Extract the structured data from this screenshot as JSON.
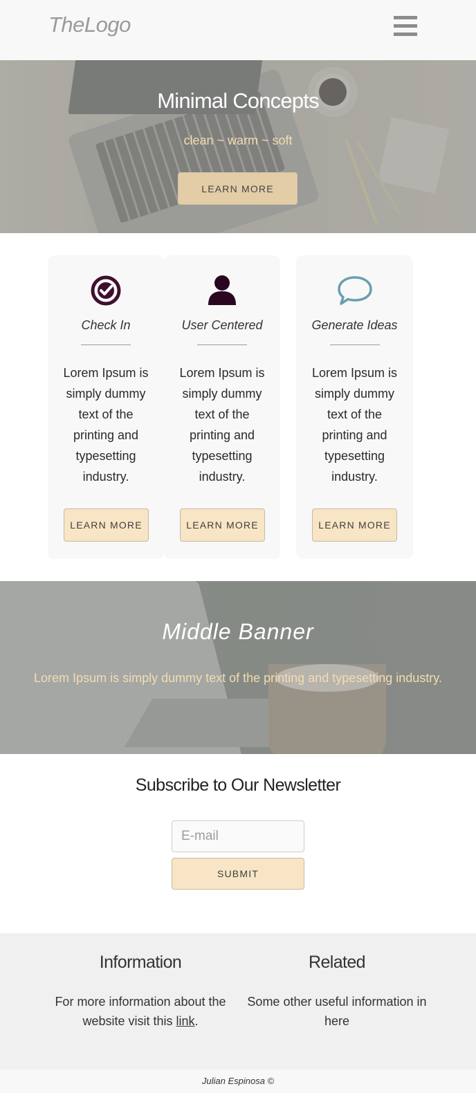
{
  "header": {
    "logo": "TheLogo",
    "menu_icon": "hamburger-menu-icon"
  },
  "hero": {
    "title": "Minimal Concepts",
    "subtitle": "clean ~ warm ~ soft",
    "button_label": "LEARN MORE"
  },
  "cards": [
    {
      "icon": "check-circle-icon",
      "title": "Check In",
      "text": "Lorem Ipsum is simply dummy text of the printing and typesetting industry.",
      "button_label": "LEARN MORE",
      "icon_color": "#3f0f2f"
    },
    {
      "icon": "user-icon",
      "title": "User Centered",
      "text": "Lorem Ipsum is simply dummy text of the printing and typesetting industry.",
      "button_label": "LEARN MORE",
      "icon_color": "#2a0620"
    },
    {
      "icon": "speech-bubble-icon",
      "title": "Generate Ideas",
      "text": "Lorem Ipsum is simply dummy text of the printing and typesetting industry.",
      "button_label": "LEARN MORE",
      "icon_color": "#6b9eae"
    }
  ],
  "middle_banner": {
    "title": "Middle Banner",
    "text": "Lorem Ipsum is simply dummy text of the printing and typesetting industry."
  },
  "newsletter": {
    "title": "Subscribe to Our Newsletter",
    "email_placeholder": "E-mail",
    "email_value": "",
    "submit_label": "SUBMIT"
  },
  "footer": {
    "information": {
      "heading": "Information",
      "text_before": "For more information about the website visit this ",
      "link_text": "link",
      "text_after": "."
    },
    "related": {
      "heading": "Related",
      "text": "Some other useful information in here"
    },
    "copyright": "Julian Espinosa ©"
  },
  "colors": {
    "accent_button": "#f8e5c5",
    "hero_subtitle": "#f4dcb0",
    "card_background": "#f8f8f8",
    "footer_background": "#f0f0f0"
  }
}
